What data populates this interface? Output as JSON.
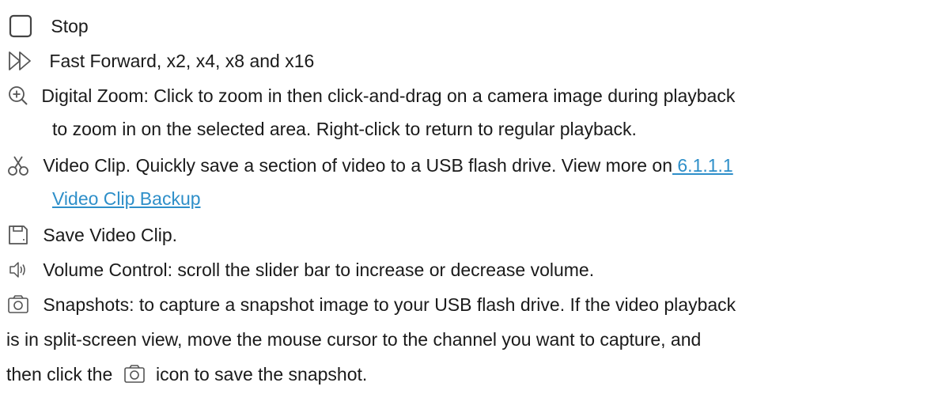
{
  "items": [
    {
      "icon": "stop-icon",
      "text": "Stop"
    },
    {
      "icon": "fast-forward-icon",
      "text": "Fast Forward, x2, x4, x8 and x16"
    },
    {
      "icon": "zoom-in-icon",
      "text": "Digital Zoom: Click to zoom in then click-and-drag on a camera image during playback",
      "text2": "to zoom in on the selected area. Right-click to return to regular playback."
    },
    {
      "icon": "scissors-icon",
      "text": "Video Clip. Quickly save a section of video to a USB flash drive. View more on",
      "link1": " 6.1.1.1",
      "link2": "Video Clip Backup"
    },
    {
      "icon": "save-icon",
      "text": "Save Video Clip."
    },
    {
      "icon": "volume-icon",
      "text": "Volume Control: scroll the slider bar to increase or decrease volume."
    },
    {
      "icon": "camera-icon",
      "text": "Snapshots: to capture a snapshot image to your USB flash drive. If the video playback",
      "text2": "is in split-screen view, move the mouse cursor to the channel you want to capture, and",
      "text3_pre": "then click the",
      "text3_post": "icon to save the snapshot."
    }
  ],
  "colors": {
    "text": "#1a1a1a",
    "link": "#2e8fc9",
    "icon": "#555555"
  }
}
